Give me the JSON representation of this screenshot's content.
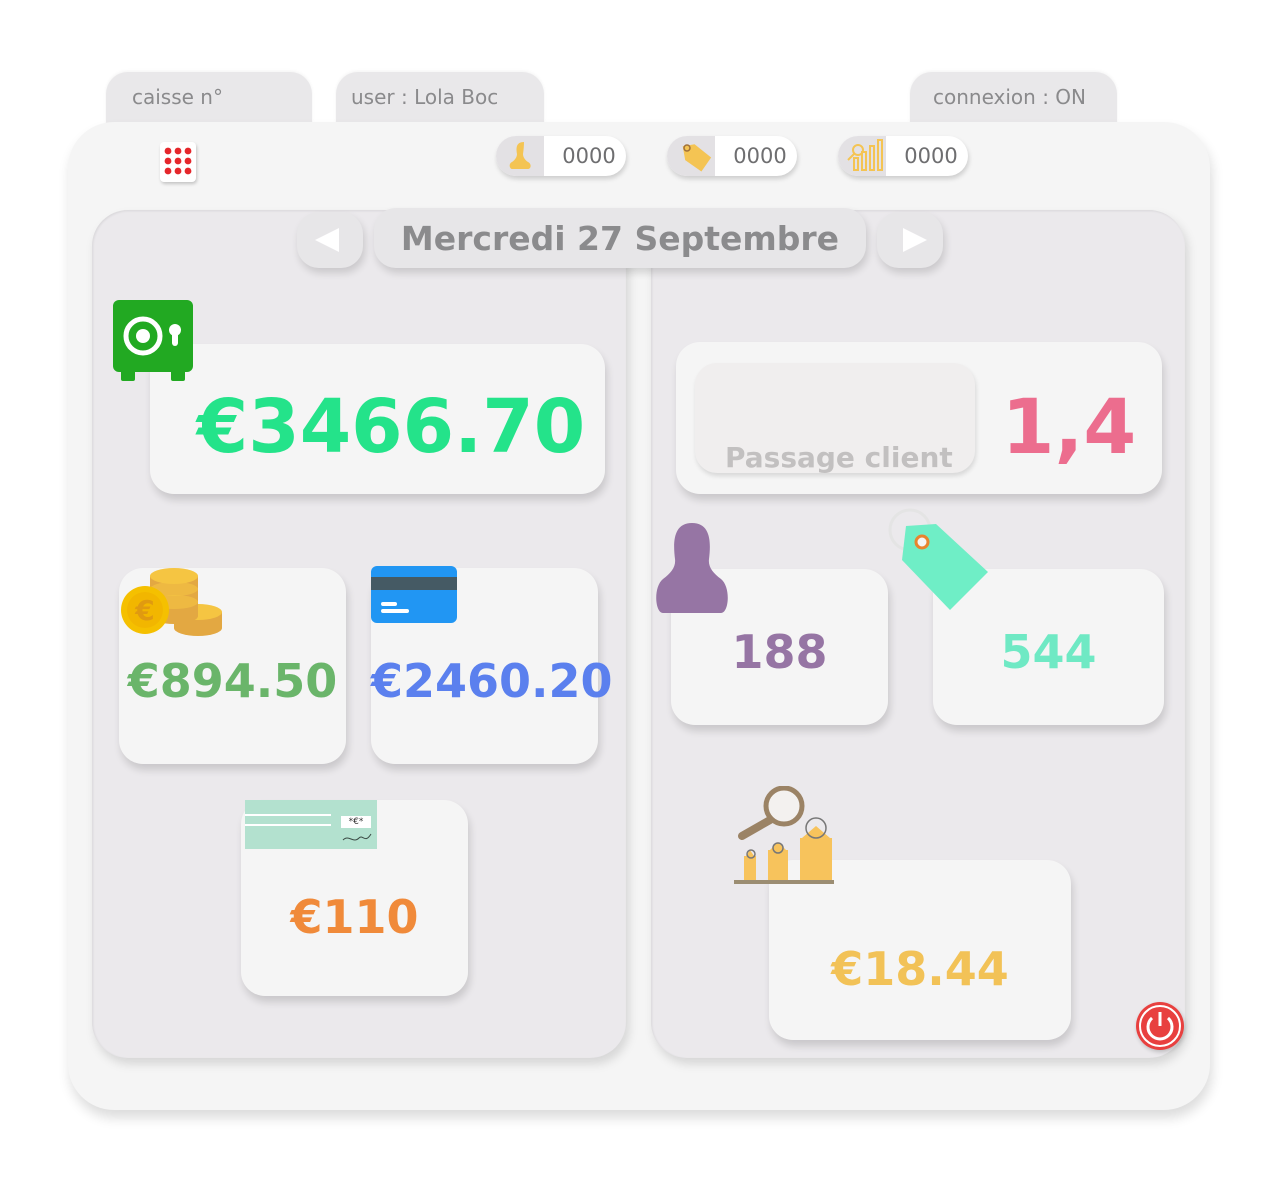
{
  "tabs": {
    "register": "caisse n°",
    "user": "user : Lola Boc",
    "connection": "connexion : ON"
  },
  "counters": [
    {
      "icon": "person-icon",
      "value": "0000"
    },
    {
      "icon": "price-tag-icon",
      "value": "0000"
    },
    {
      "icon": "growth-chart-icon",
      "value": "0000"
    }
  ],
  "date_label": "Mercredi 27 Septembre",
  "left": {
    "safe_total": "€3466.70",
    "cash": "€894.50",
    "card": "€2460.20",
    "check": "€110",
    "check_symbol": "*€*"
  },
  "right": {
    "passage_label": "Passage client",
    "passage_value": "1,4",
    "customers": "188",
    "articles": "544",
    "average_basket": "€18.44"
  },
  "colors": {
    "safe": "#24e38a",
    "cash": "#6ab56a",
    "card": "#5b80ee",
    "check": "#f08a3a",
    "passage": "#ec6d8e",
    "customers": "#9675a4",
    "articles": "#6fe9c4",
    "basket": "#f2c257",
    "power": "#e8403f"
  }
}
